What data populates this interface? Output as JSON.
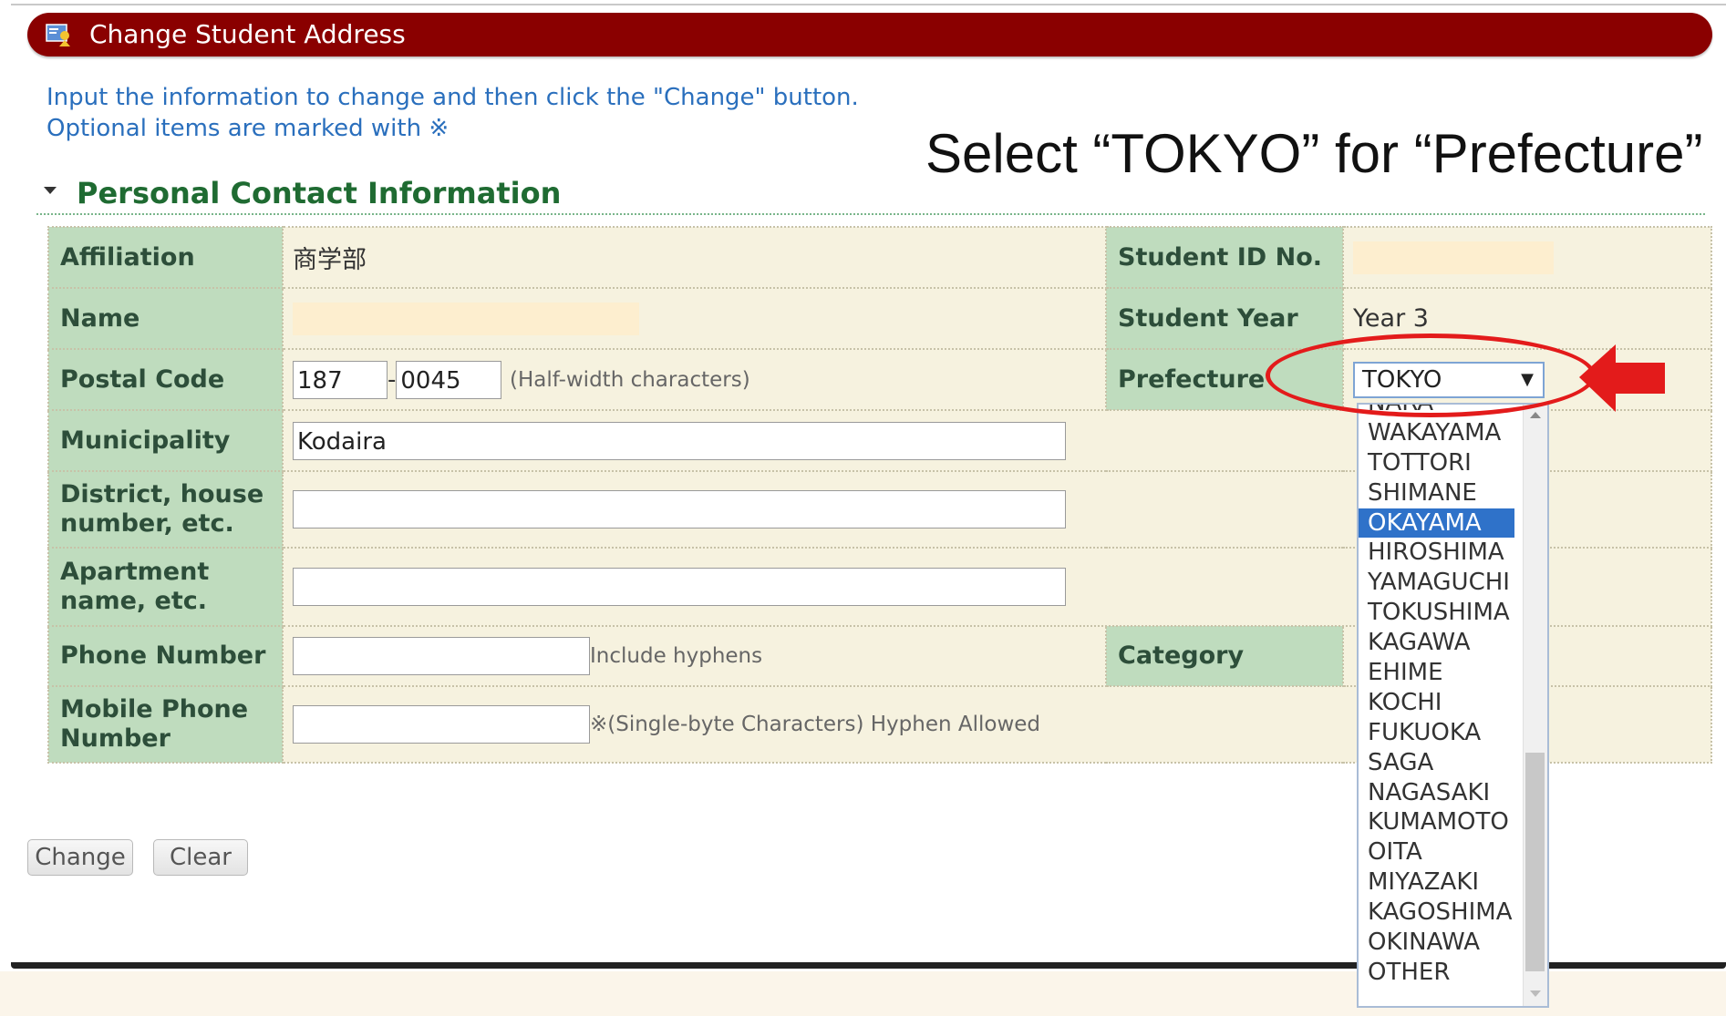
{
  "window": {
    "title": "Change Student Address",
    "title_icon": "student-card-icon"
  },
  "instructions": {
    "line1": "Input the information to change and then click the \"Change\" button.",
    "line2": "Optional items are marked with ※"
  },
  "annotation": "Select “TOKYO” for “Prefecture”",
  "section": {
    "heading": "Personal Contact Information"
  },
  "form": {
    "affiliation": {
      "label": "Affiliation",
      "value": "商学部"
    },
    "student_id": {
      "label": "Student ID No.",
      "value": ""
    },
    "name": {
      "label": "Name",
      "value": ""
    },
    "student_year": {
      "label": "Student Year",
      "value": "Year 3"
    },
    "postal_code": {
      "label": "Postal Code",
      "part1": "187",
      "separator": "-",
      "part2": "0045",
      "hint": "(Half-width characters)"
    },
    "prefecture": {
      "label": "Prefecture",
      "selected": "TOKYO"
    },
    "municipality": {
      "label": "Municipality",
      "value": "Kodaira"
    },
    "district": {
      "label_line1": "District, house",
      "label_line2": "number, etc.",
      "value": ""
    },
    "apartment": {
      "label_line1": "Apartment",
      "label_line2": "name, etc.",
      "value": ""
    },
    "phone": {
      "label": "Phone Number",
      "value": "",
      "hint": "Include hyphens"
    },
    "category": {
      "label": "Category"
    },
    "mobile": {
      "label_line1": "Mobile Phone",
      "label_line2": "Number",
      "value": "",
      "hint": "※(Single-byte Characters) Hyphen Allowed"
    }
  },
  "buttons": {
    "change": "Change",
    "clear": "Clear"
  },
  "dropdown": {
    "items": [
      "NARA",
      "WAKAYAMA",
      "TOTTORI",
      "SHIMANE",
      "OKAYAMA",
      "HIROSHIMA",
      "YAMAGUCHI",
      "TOKUSHIMA",
      "KAGAWA",
      "EHIME",
      "KOCHI",
      "FUKUOKA",
      "SAGA",
      "NAGASAKI",
      "KUMAMOTO",
      "OITA",
      "MIYAZAKI",
      "KAGOSHIMA",
      "OKINAWA",
      "OTHER"
    ],
    "highlighted": "OKAYAMA"
  },
  "colors": {
    "title_bar": "#8a0000",
    "label_cell": "#bfdcbe",
    "value_cell": "#f6f2df",
    "instruction_text": "#2a6fbd",
    "heading_text": "#1f6b32",
    "highlight_select": "#2f72c9",
    "annotation_red": "#e31b1b"
  }
}
